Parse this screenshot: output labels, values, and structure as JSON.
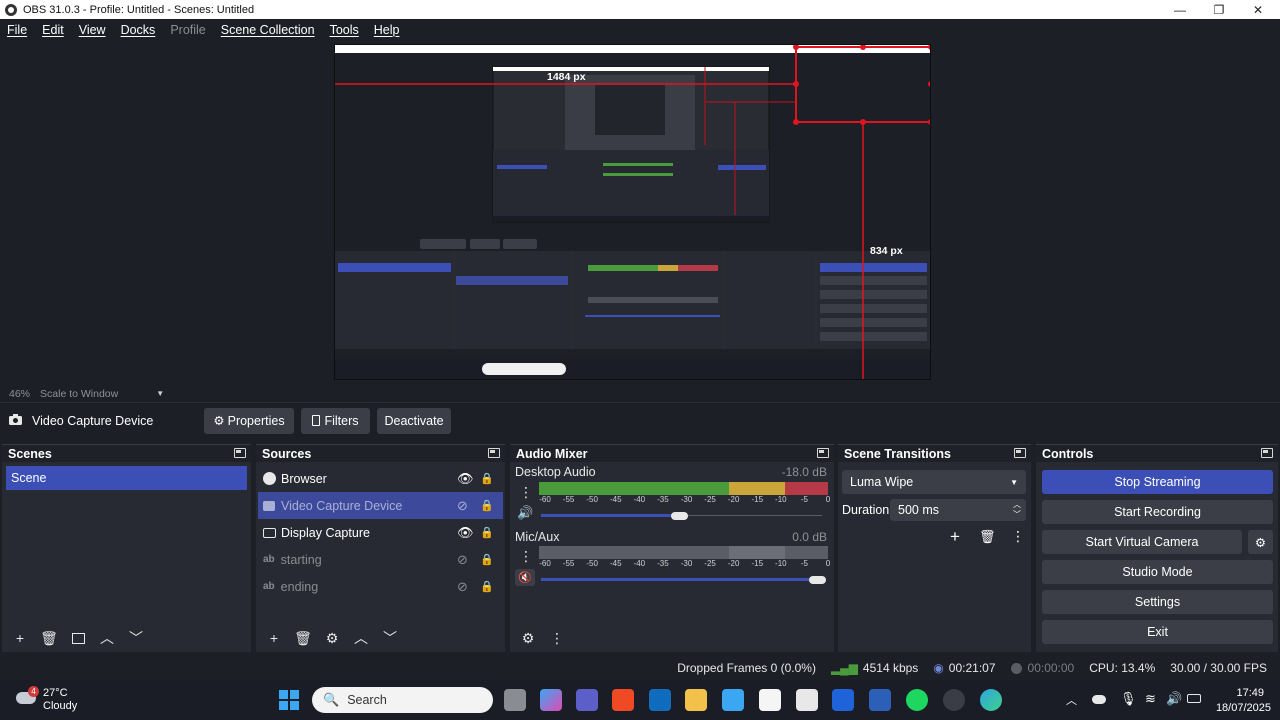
{
  "window": {
    "title": "OBS 31.0.3 - Profile: Untitled - Scenes: Untitled",
    "minimize": "—",
    "maximize": "❐",
    "close": "✕"
  },
  "menu": [
    {
      "label": "File",
      "enabled": true
    },
    {
      "label": "Edit",
      "enabled": true
    },
    {
      "label": "View",
      "enabled": true
    },
    {
      "label": "Docks",
      "enabled": true
    },
    {
      "label": "Profile",
      "enabled": false
    },
    {
      "label": "Scene Collection",
      "enabled": true
    },
    {
      "label": "Tools",
      "enabled": true
    },
    {
      "label": "Help",
      "enabled": true
    }
  ],
  "preview": {
    "measure_width": "1484 px",
    "measure_height": "834 px"
  },
  "zoom": {
    "level": "46%",
    "mode": "Scale to Window"
  },
  "source_toolbar": {
    "source_name": "Video Capture Device",
    "properties": "Properties",
    "filters": "Filters",
    "deactivate": "Deactivate"
  },
  "scenes": {
    "title": "Scenes",
    "items": [
      "Scene"
    ]
  },
  "sources": {
    "title": "Sources",
    "items": [
      {
        "name": "Browser",
        "icon": "globe-icon",
        "visible": true,
        "state": "normal"
      },
      {
        "name": "Video Capture Device",
        "icon": "camera-icon",
        "visible": false,
        "state": "selected"
      },
      {
        "name": "Display Capture",
        "icon": "monitor-icon",
        "visible": true,
        "state": "normal"
      },
      {
        "name": "starting",
        "icon": "text-icon",
        "visible": false,
        "state": "faded"
      },
      {
        "name": "ending",
        "icon": "text-icon",
        "visible": false,
        "state": "faded"
      }
    ]
  },
  "audio_mixer": {
    "title": "Audio Mixer",
    "channels": [
      {
        "name": "Desktop Audio",
        "level": "-18.0 dB",
        "volume": 0.51
      },
      {
        "name": "Mic/Aux",
        "level": "0.0 dB",
        "volume": 1.0
      }
    ],
    "ticks": [
      "-60",
      "-55",
      "-50",
      "-45",
      "-40",
      "-35",
      "-30",
      "-25",
      "-20",
      "-15",
      "-10",
      "-5",
      "0"
    ]
  },
  "scene_transitions": {
    "title": "Scene Transitions",
    "transition": "Luma Wipe",
    "duration_label": "Duration",
    "duration_value": "500 ms"
  },
  "controls": {
    "title": "Controls",
    "buttons": [
      "Stop Streaming",
      "Start Recording",
      "Start Virtual Camera",
      "Studio Mode",
      "Settings",
      "Exit"
    ]
  },
  "status": {
    "dropped_frames": "Dropped Frames 0 (0.0%)",
    "bitrate": "4514 kbps",
    "stream_time": "00:21:07",
    "record_time": "00:00:00",
    "cpu": "CPU: 13.4%",
    "fps": "30.00 / 30.00 FPS"
  },
  "taskbar": {
    "weather_temp": "27°C",
    "weather_desc": "Cloudy",
    "weather_badge": "4",
    "search": "Search",
    "time": "17:49",
    "date": "18/07/2025"
  },
  "colors": {
    "accent": "#3b4fb6",
    "panel": "#272a33",
    "background": "#1d1f26",
    "meter_green": "#4a9b3b",
    "meter_yellow": "#c9a53a",
    "meter_red": "#b43a45"
  }
}
